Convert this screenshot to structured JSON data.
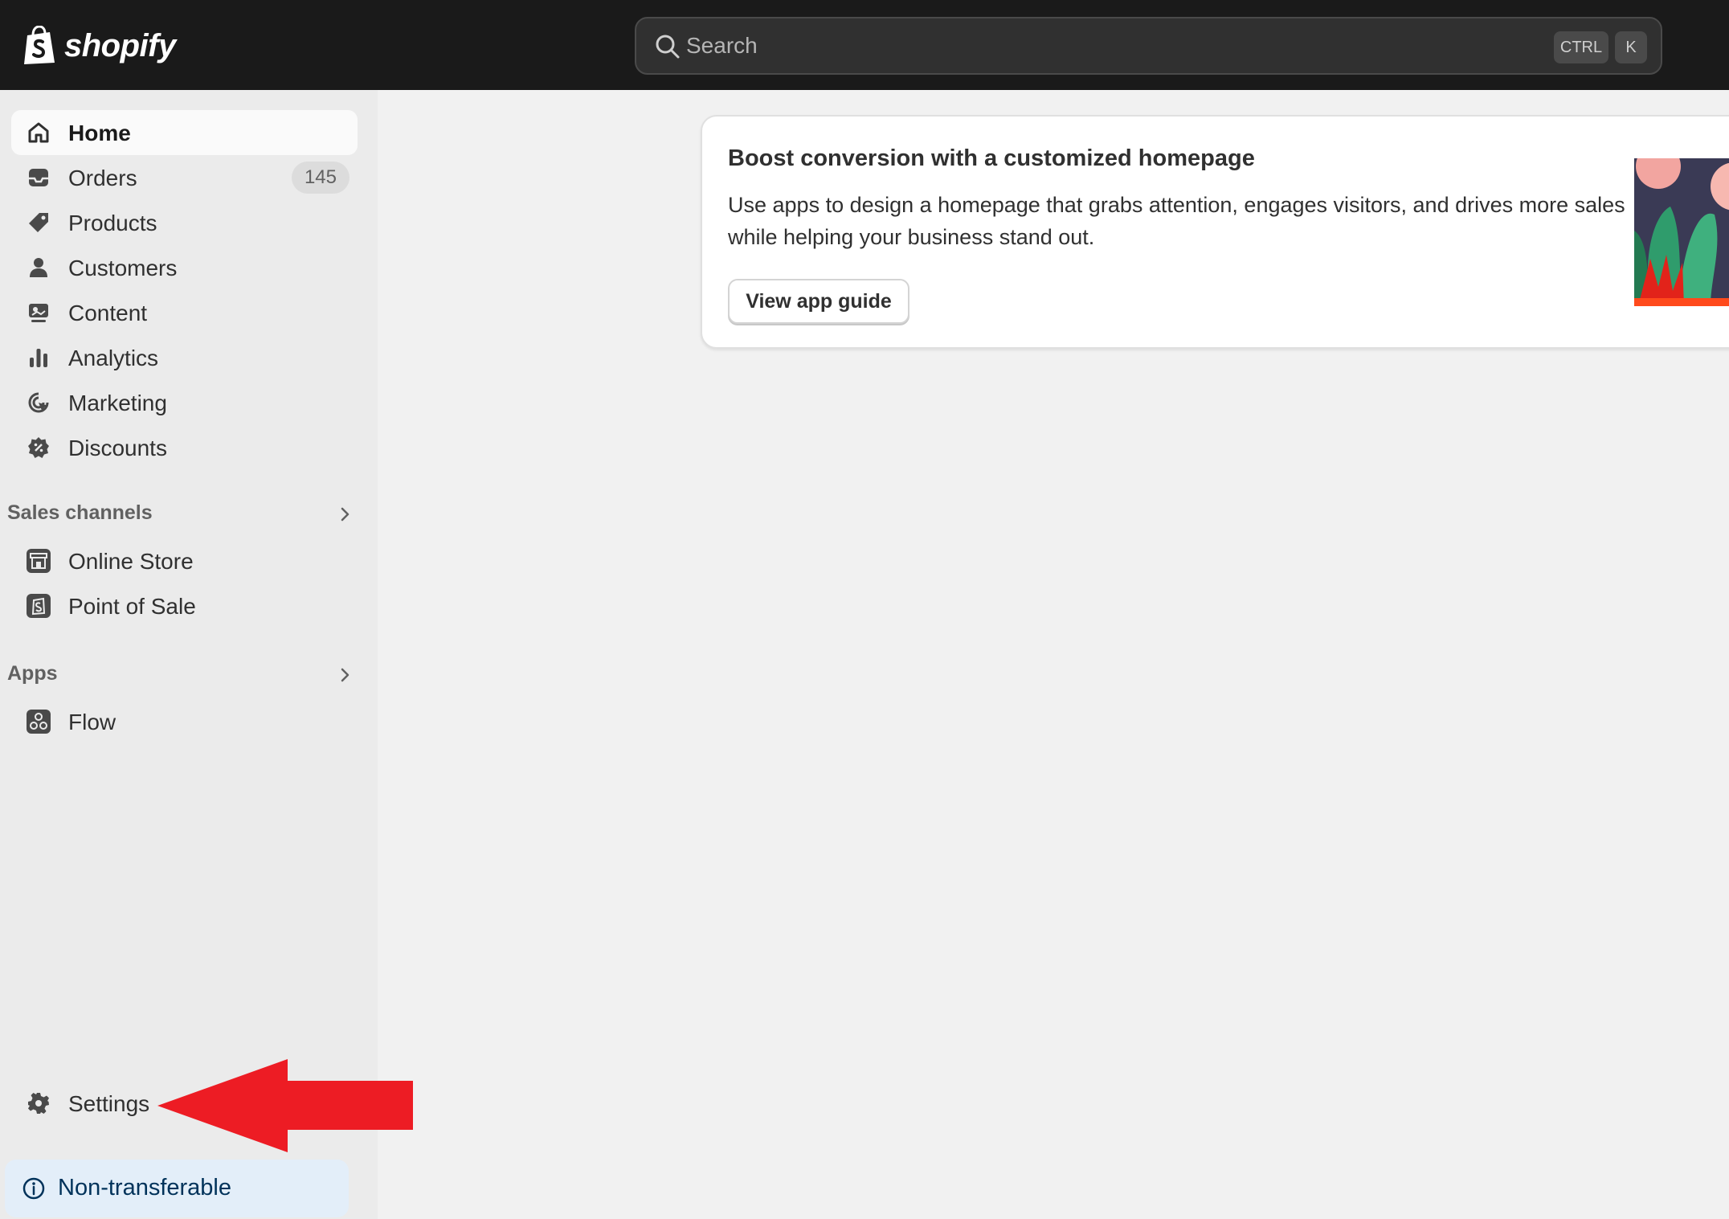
{
  "topbar": {
    "logo_text": "shopify",
    "search": {
      "placeholder": "Search",
      "shortcut_modifier": "CTRL",
      "shortcut_key": "K"
    }
  },
  "sidebar": {
    "items": [
      {
        "label": "Home",
        "icon": "home-icon",
        "active": true
      },
      {
        "label": "Orders",
        "icon": "inbox-icon",
        "badge": "145"
      },
      {
        "label": "Products",
        "icon": "tag-icon"
      },
      {
        "label": "Customers",
        "icon": "person-icon"
      },
      {
        "label": "Content",
        "icon": "content-icon"
      },
      {
        "label": "Analytics",
        "icon": "bar-chart-icon"
      },
      {
        "label": "Marketing",
        "icon": "target-icon"
      },
      {
        "label": "Discounts",
        "icon": "discount-icon"
      }
    ],
    "sales_channels": {
      "header": "Sales channels",
      "items": [
        {
          "label": "Online Store",
          "icon": "store-icon"
        },
        {
          "label": "Point of Sale",
          "icon": "pos-icon"
        }
      ]
    },
    "apps": {
      "header": "Apps",
      "items": [
        {
          "label": "Flow",
          "icon": "flow-icon"
        }
      ]
    },
    "settings_label": "Settings",
    "plan_banner": "Non-transferable"
  },
  "main": {
    "card": {
      "title": "Boost conversion with a customized homepage",
      "body": "Use apps to design a homepage that grabs attention, engages visitors, and drives more sales while helping your business stand out.",
      "button_label": "View app guide"
    }
  },
  "colors": {
    "topbar_bg": "#1a1a1a",
    "sidebar_bg": "#ebebeb",
    "page_bg": "#f1f1f1",
    "annotation_arrow": "#ed1c24",
    "banner_bg": "#e3eef9"
  }
}
